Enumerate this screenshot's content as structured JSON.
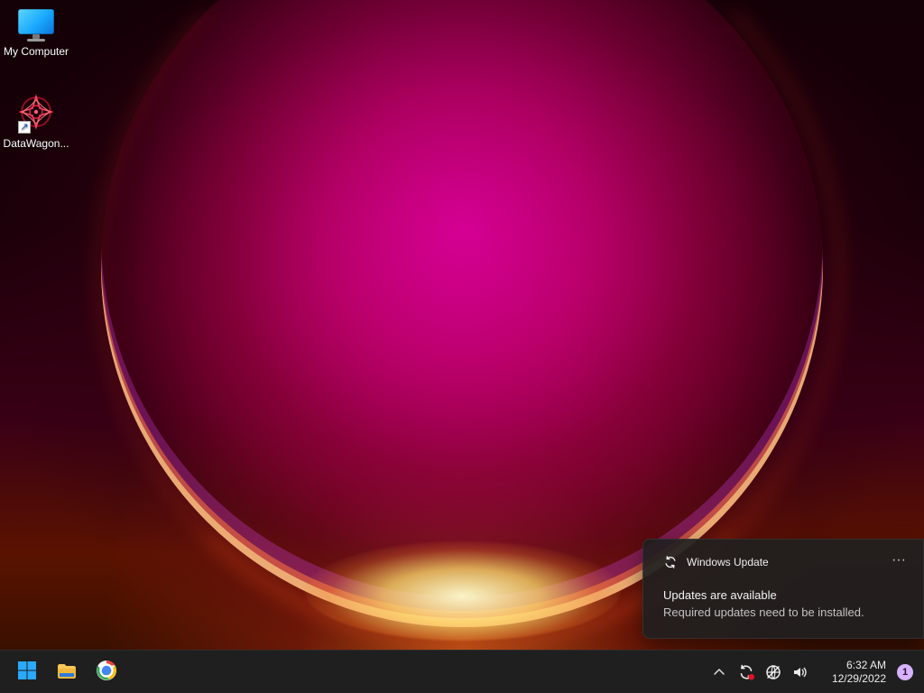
{
  "desktop": {
    "icons": [
      {
        "label": "My Computer",
        "icon": "computer-icon"
      },
      {
        "label": "DataWagon...",
        "icon": "datawagon-icon"
      }
    ]
  },
  "toast": {
    "app_name": "Windows Update",
    "app_icon": "sync-icon",
    "more_label": "···",
    "title": "Updates are available",
    "body": "Required updates need to be installed."
  },
  "taskbar": {
    "apps": [
      {
        "name": "Start",
        "icon": "windows-logo-icon"
      },
      {
        "name": "File Explorer",
        "icon": "folder-icon"
      },
      {
        "name": "Google Chrome",
        "icon": "chrome-icon"
      }
    ],
    "tray": {
      "icons": [
        "chevron-up-icon",
        "windows-update-status-icon",
        "network-globe-icon",
        "volume-icon"
      ],
      "time": "6:32 AM",
      "date": "12/29/2022",
      "notification_count": "1"
    }
  },
  "colors": {
    "taskbar_bg": "#202020",
    "toast_bg": "#202020",
    "accent_blue": "#2aa9ff",
    "notification_badge": "#d7b2ff"
  }
}
